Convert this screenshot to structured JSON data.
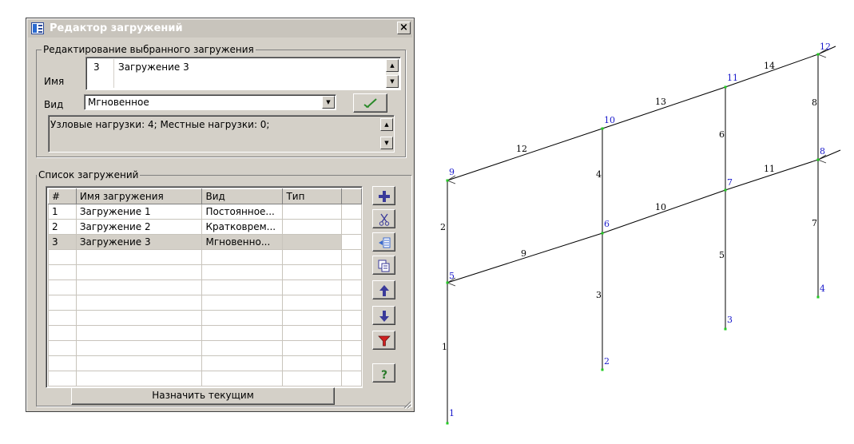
{
  "window": {
    "title": "Редактор загружений",
    "close_label": "×"
  },
  "edit_group": {
    "legend": "Редактирование выбранного загружения",
    "name_label": "Имя",
    "name_number": "3",
    "name_value": "Загружение 3",
    "type_label": "Вид",
    "type_value": "Мгновенное",
    "info_text": "Узловые нагрузки: 4; Местные нагрузки: 0;"
  },
  "list_group": {
    "legend": "Список загружений",
    "columns": [
      "#",
      "Имя загружения",
      "Вид",
      "Тип"
    ],
    "rows": [
      [
        "1",
        "Загружение 1",
        "Постоянное...",
        ""
      ],
      [
        "2",
        "Загружение 2",
        "Кратковрем...",
        ""
      ],
      [
        "3",
        "Загружение 3",
        "Мгновенно...",
        ""
      ]
    ],
    "selected_row": 3,
    "assign_button": "Назначить текущим",
    "toolbar": [
      "add-icon",
      "cut-icon",
      "insert-icon",
      "copy-icon",
      "move-up-icon",
      "move-down-icon",
      "filter-icon",
      "help-icon"
    ]
  },
  "model": {
    "node_labels": [
      "1",
      "2",
      "3",
      "4",
      "5",
      "6",
      "7",
      "8",
      "9",
      "10",
      "11",
      "12"
    ],
    "element_labels": [
      "1",
      "2",
      "3",
      "4",
      "5",
      "6",
      "7",
      "8",
      "9",
      "10",
      "11",
      "12",
      "13",
      "14"
    ],
    "node_color": "#1a1acc",
    "element_color": "#000000",
    "node_marker_color": "#22cc22"
  }
}
